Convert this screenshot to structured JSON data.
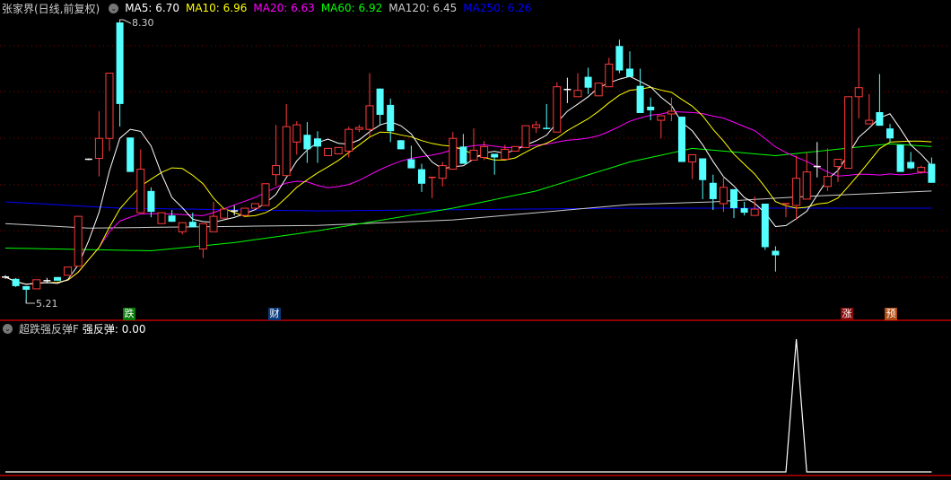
{
  "header": {
    "title": "张家界(日线,前复权)",
    "ma": [
      {
        "label": "MA5: 6.70",
        "color": "#ffffff"
      },
      {
        "label": "MA10: 6.96",
        "color": "#ffff00"
      },
      {
        "label": "MA20: 6.63",
        "color": "#ff00ff"
      },
      {
        "label": "MA60: 6.92",
        "color": "#00ff00"
      },
      {
        "label": "MA120: 6.45",
        "color": "#cccccc"
      },
      {
        "label": "MA250: 6.26",
        "color": "#0000ff"
      }
    ]
  },
  "price_marks": {
    "high": "8.30",
    "low": "5.21"
  },
  "signals": [
    {
      "text": "跌",
      "bg": "#0a7a0a",
      "index": 11
    },
    {
      "text": "财",
      "bg": "#0a3a7a",
      "index": 26
    },
    {
      "text": "涨",
      "bg": "#8a0a0a",
      "index": 81
    },
    {
      "text": "预",
      "bg": "#b04a10",
      "index": 85
    }
  ],
  "indicator": {
    "name": "超跌强反弹F",
    "value_label": "强反弹: 0.00"
  },
  "chart_data": {
    "type": "candlestick",
    "ylim": [
      5.21,
      8.3
    ],
    "candles_ohlc": [
      [
        5.5,
        5.52,
        5.48,
        5.5
      ],
      [
        5.48,
        5.49,
        5.39,
        5.4
      ],
      [
        5.4,
        5.4,
        5.21,
        5.36
      ],
      [
        5.37,
        5.47,
        5.37,
        5.47
      ],
      [
        5.46,
        5.49,
        5.43,
        5.46
      ],
      [
        5.5,
        5.5,
        5.46,
        5.46
      ],
      [
        5.52,
        5.61,
        5.52,
        5.61
      ],
      [
        5.62,
        6.17,
        5.62,
        6.17
      ],
      [
        6.8,
        6.81,
        6.79,
        6.8
      ],
      [
        6.81,
        7.33,
        6.61,
        7.03
      ],
      [
        7.03,
        7.75,
        6.89,
        7.75
      ],
      [
        8.31,
        8.31,
        7.16,
        7.41
      ],
      [
        7.04,
        7.04,
        6.66,
        6.66
      ],
      [
        6.21,
        6.91,
        6.21,
        6.69
      ],
      [
        6.45,
        6.49,
        6.16,
        6.22
      ],
      [
        6.09,
        6.21,
        6.09,
        6.21
      ],
      [
        6.18,
        6.24,
        6.11,
        6.11
      ],
      [
        6.0,
        6.1,
        5.97,
        6.1
      ],
      [
        6.11,
        6.21,
        6.05,
        6.05
      ],
      [
        5.81,
        6.09,
        5.71,
        6.09
      ],
      [
        6.0,
        6.33,
        6.0,
        6.17
      ],
      [
        6.15,
        6.25,
        6.15,
        6.25
      ],
      [
        6.23,
        6.29,
        6.18,
        6.23
      ],
      [
        6.18,
        6.26,
        6.18,
        6.26
      ],
      [
        6.26,
        6.31,
        6.26,
        6.31
      ],
      [
        6.29,
        6.53,
        6.29,
        6.53
      ],
      [
        6.63,
        7.18,
        6.51,
        6.73
      ],
      [
        6.62,
        7.41,
        6.62,
        7.16
      ],
      [
        6.99,
        7.22,
        6.85,
        7.18
      ],
      [
        7.07,
        7.21,
        6.76,
        6.91
      ],
      [
        7.03,
        7.11,
        6.76,
        6.94
      ],
      [
        6.84,
        6.92,
        6.84,
        6.92
      ],
      [
        6.86,
        6.93,
        6.86,
        6.93
      ],
      [
        6.89,
        7.16,
        6.82,
        7.13
      ],
      [
        7.13,
        7.18,
        7.1,
        7.15
      ],
      [
        7.13,
        7.75,
        7.05,
        7.39
      ],
      [
        7.58,
        7.58,
        7.18,
        7.29
      ],
      [
        7.4,
        7.47,
        6.99,
        7.11
      ],
      [
        7.01,
        7.01,
        6.91,
        6.91
      ],
      [
        6.8,
        6.95,
        6.7,
        6.7
      ],
      [
        6.69,
        6.75,
        6.44,
        6.53
      ],
      [
        6.59,
        6.6,
        6.37,
        6.6
      ],
      [
        6.59,
        6.77,
        6.5,
        6.73
      ],
      [
        6.69,
        7.1,
        6.69,
        7.03
      ],
      [
        6.94,
        7.08,
        6.75,
        6.75
      ],
      [
        6.79,
        7.14,
        6.79,
        6.9
      ],
      [
        6.82,
        7.0,
        6.79,
        6.94
      ],
      [
        6.86,
        6.86,
        6.63,
        6.82
      ],
      [
        6.8,
        6.96,
        6.8,
        6.91
      ],
      [
        6.89,
        6.94,
        6.89,
        6.94
      ],
      [
        6.93,
        7.17,
        6.93,
        7.17
      ],
      [
        7.15,
        7.22,
        7.09,
        7.18
      ],
      [
        7.14,
        7.41,
        7.13,
        7.13
      ],
      [
        7.1,
        7.65,
        7.1,
        7.6
      ],
      [
        7.57,
        7.7,
        7.42,
        7.57
      ],
      [
        7.49,
        7.75,
        7.49,
        7.56
      ],
      [
        7.71,
        7.81,
        7.52,
        7.59
      ],
      [
        7.5,
        7.64,
        7.5,
        7.64
      ],
      [
        7.6,
        7.92,
        7.6,
        7.85
      ],
      [
        8.05,
        8.12,
        7.75,
        7.78
      ],
      [
        7.8,
        7.99,
        7.71,
        7.71
      ],
      [
        7.61,
        7.8,
        7.31,
        7.31
      ],
      [
        7.38,
        7.48,
        7.23,
        7.34
      ],
      [
        7.23,
        7.28,
        7.03,
        7.28
      ],
      [
        7.3,
        7.48,
        7.22,
        7.33
      ],
      [
        7.27,
        7.27,
        6.77,
        6.77
      ],
      [
        6.77,
        6.85,
        6.58,
        6.85
      ],
      [
        6.81,
        6.81,
        6.36,
        6.57
      ],
      [
        6.54,
        6.63,
        6.24,
        6.36
      ],
      [
        6.31,
        6.61,
        6.22,
        6.49
      ],
      [
        6.47,
        6.47,
        6.15,
        6.26
      ],
      [
        6.26,
        6.33,
        6.18,
        6.21
      ],
      [
        6.18,
        6.39,
        6.18,
        6.25
      ],
      [
        6.31,
        6.31,
        5.8,
        5.83
      ],
      [
        5.79,
        5.84,
        5.56,
        5.74
      ],
      [
        6.3,
        6.31,
        6.16,
        6.31
      ],
      [
        6.29,
        6.84,
        6.13,
        6.59
      ],
      [
        6.36,
        6.87,
        6.36,
        6.66
      ],
      [
        6.72,
        6.99,
        6.6,
        6.72
      ],
      [
        6.5,
        6.92,
        6.45,
        6.61
      ],
      [
        6.72,
        6.8,
        6.55,
        6.8
      ],
      [
        6.7,
        7.49,
        6.7,
        7.49
      ],
      [
        7.49,
        8.25,
        7.25,
        7.59
      ],
      [
        7.19,
        7.52,
        7.19,
        7.23
      ],
      [
        7.32,
        7.74,
        7.17,
        7.17
      ],
      [
        7.14,
        7.19,
        6.99,
        7.03
      ],
      [
        6.96,
        6.96,
        6.66,
        6.66
      ],
      [
        6.77,
        6.88,
        6.69,
        6.7
      ],
      [
        6.66,
        6.73,
        6.64,
        6.71
      ],
      [
        6.75,
        6.82,
        6.54,
        6.54
      ]
    ],
    "ma60_points": [
      [
        0,
        5.82
      ],
      [
        14,
        5.79
      ],
      [
        22,
        5.88
      ],
      [
        30,
        6.01
      ],
      [
        43,
        6.26
      ],
      [
        51,
        6.45
      ],
      [
        60,
        6.77
      ],
      [
        66,
        6.92
      ],
      [
        74,
        6.84
      ],
      [
        85,
        6.97
      ],
      [
        89,
        6.94
      ]
    ],
    "ma120_points": [
      [
        0,
        6.09
      ],
      [
        8,
        6.04
      ],
      [
        30,
        6.07
      ],
      [
        43,
        6.13
      ],
      [
        60,
        6.3
      ],
      [
        68,
        6.33
      ],
      [
        77,
        6.39
      ],
      [
        89,
        6.45
      ]
    ],
    "ma250_points": [
      [
        0,
        6.33
      ],
      [
        11,
        6.26
      ],
      [
        30,
        6.23
      ],
      [
        60,
        6.26
      ],
      [
        89,
        6.26
      ]
    ],
    "indicator_values": {
      "peak_index": 76,
      "peak_value": 1,
      "baseline": 0
    }
  }
}
